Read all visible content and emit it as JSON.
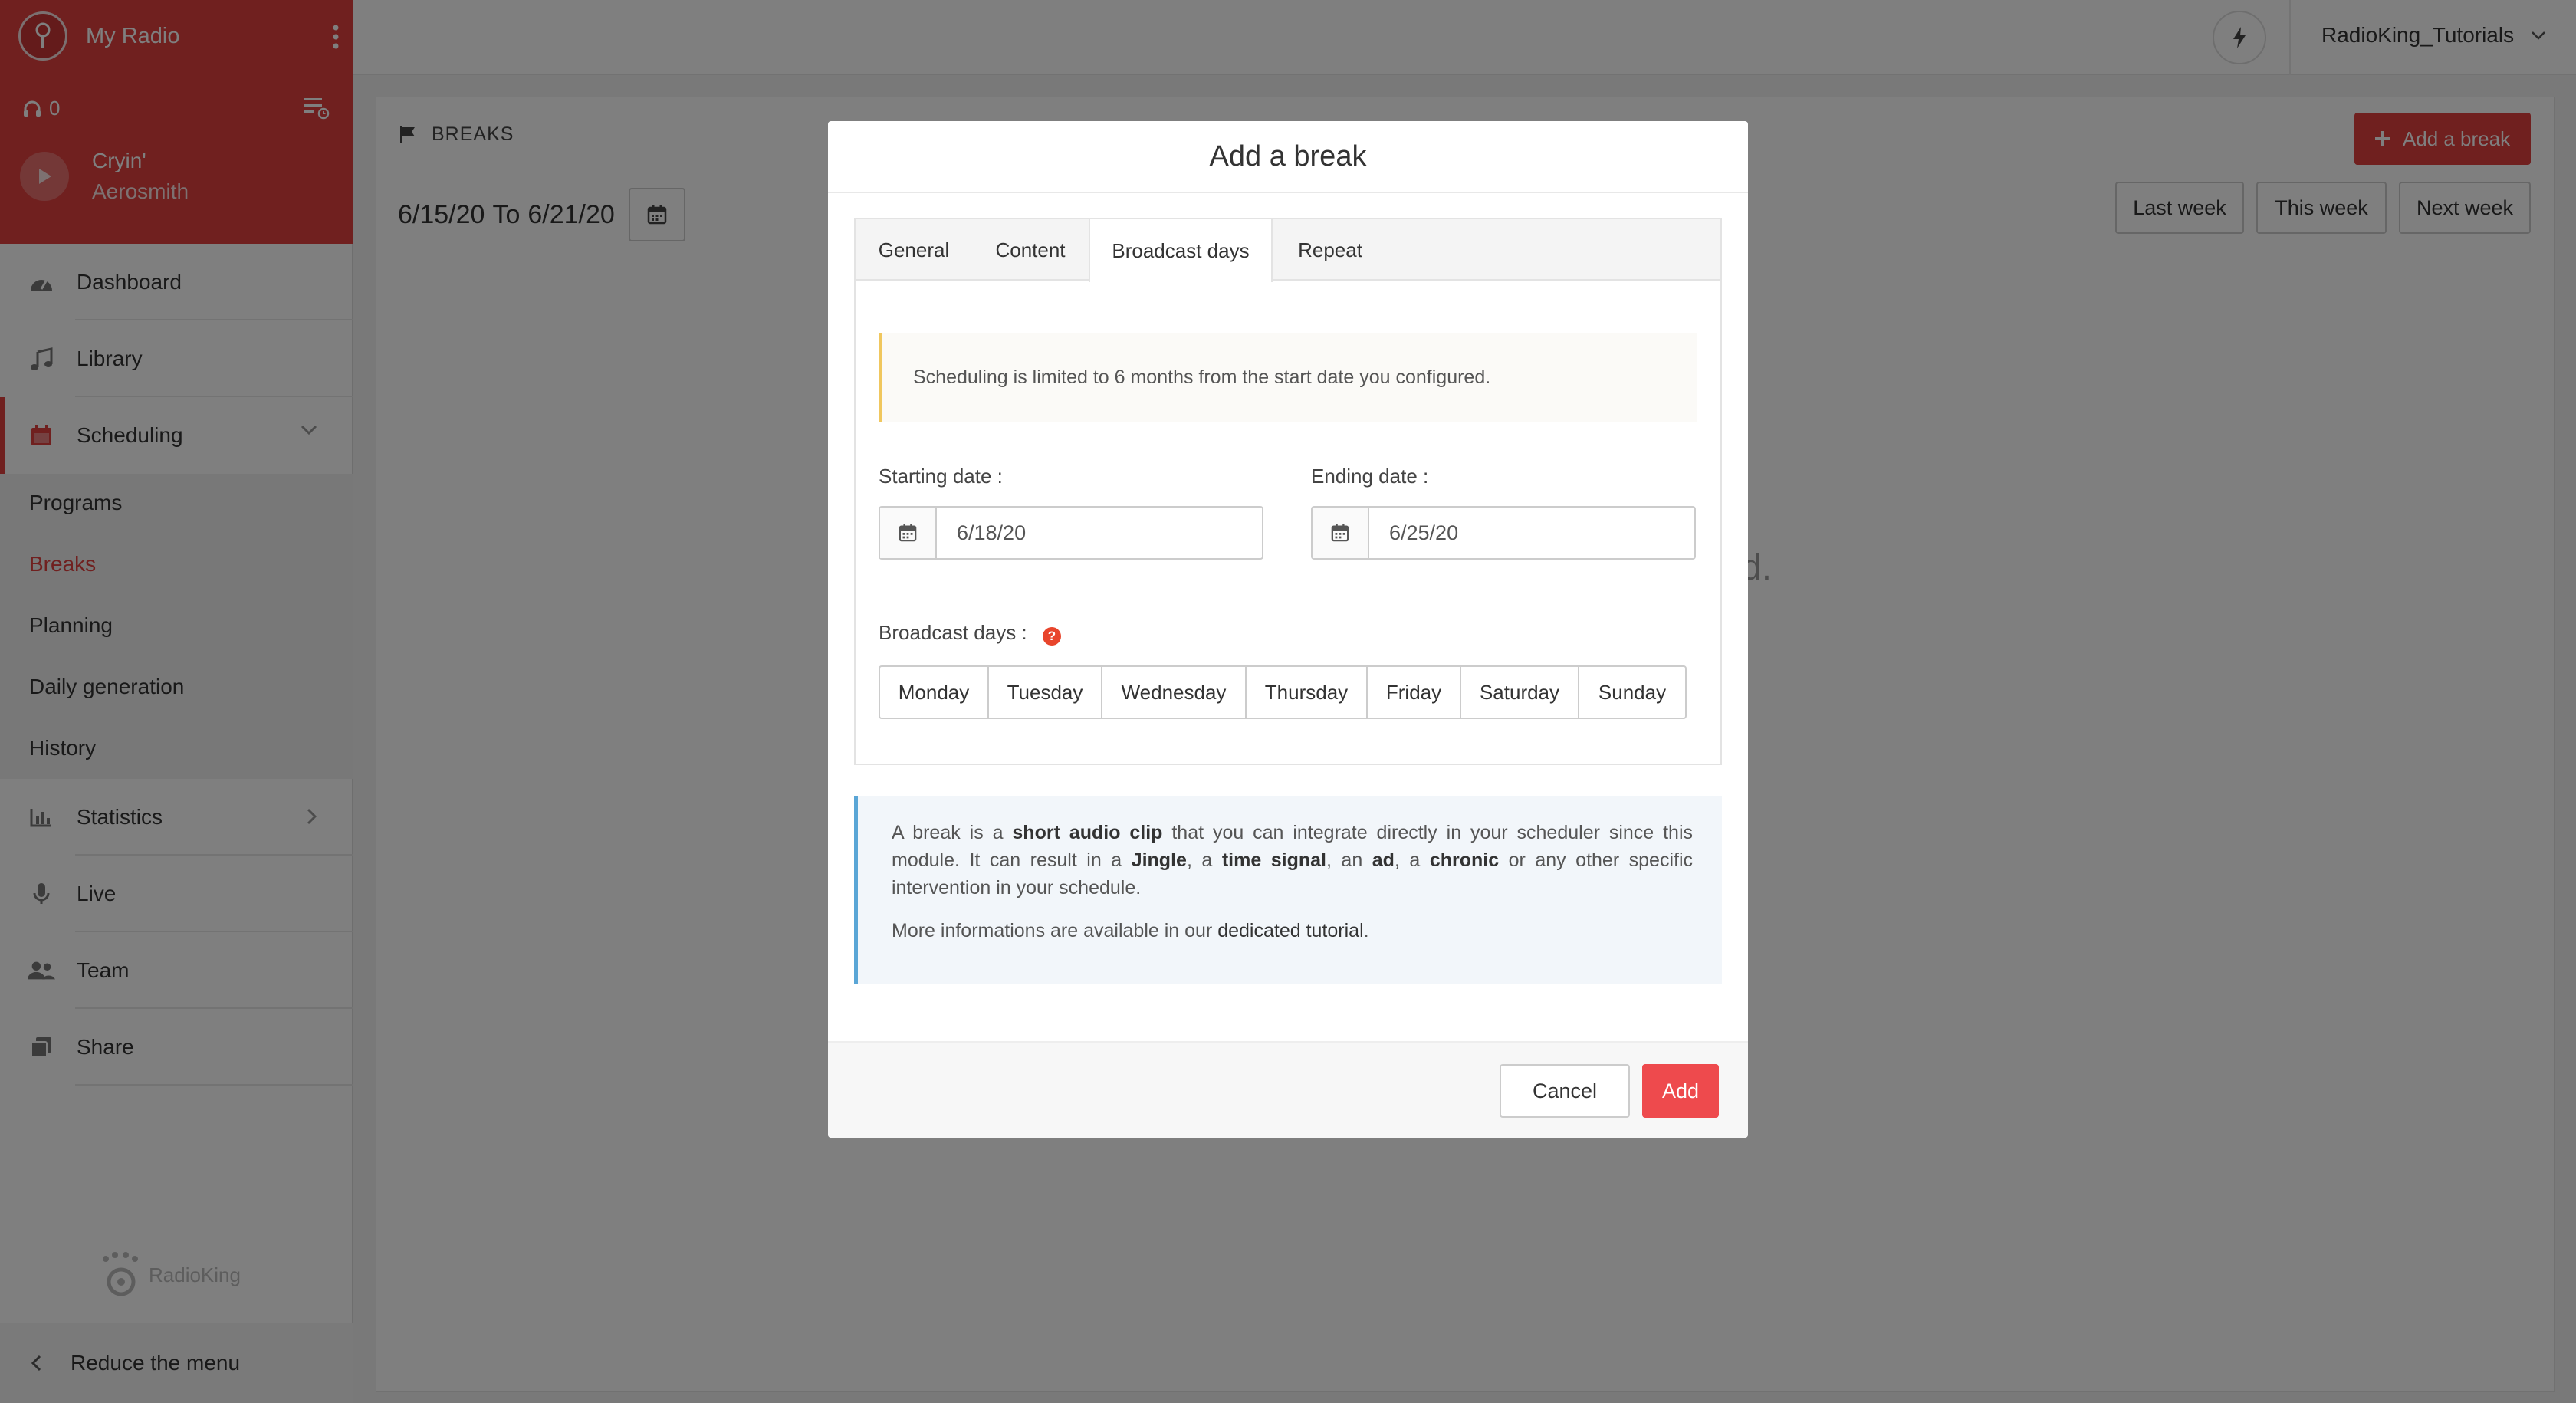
{
  "colors": {
    "accent": "#e0403f",
    "warning": "#f0c75e",
    "info": "#5aa6d6",
    "help": "#e8452c"
  },
  "sidebar": {
    "radio_name": "My Radio",
    "listeners": "0",
    "track": {
      "title": "Cryin'",
      "artist": "Aerosmith"
    },
    "items": [
      {
        "label": "Dashboard",
        "icon": "gauge-icon"
      },
      {
        "label": "Library",
        "icon": "music-note-icon"
      },
      {
        "label": "Scheduling",
        "icon": "calendar-icon",
        "active": true
      },
      {
        "label": "Statistics",
        "icon": "bar-chart-icon"
      },
      {
        "label": "Live",
        "icon": "microphone-icon"
      },
      {
        "label": "Team",
        "icon": "users-icon"
      },
      {
        "label": "Share",
        "icon": "share-icon"
      }
    ],
    "sub_items": [
      {
        "label": "Programs"
      },
      {
        "label": "Breaks",
        "active": true
      },
      {
        "label": "Planning"
      },
      {
        "label": "Daily generation"
      },
      {
        "label": "History"
      }
    ],
    "brand": "RadioKing",
    "reduce_label": "Reduce the menu"
  },
  "topbar": {
    "username": "RadioKing_Tutorials"
  },
  "main": {
    "section_title": "BREAKS",
    "date_from": "6/15/20",
    "date_to_word": "To",
    "date_to": "6/21/20",
    "add_break_label": "Add a break",
    "week_buttons": [
      "Last week",
      "This week",
      "Next week"
    ],
    "empty_hint_tail": "d."
  },
  "modal": {
    "title": "Add a break",
    "tabs": [
      "General",
      "Content",
      "Broadcast days",
      "Repeat"
    ],
    "active_tab": "Broadcast days",
    "warning": "Scheduling is limited to 6 months from the start date you configured.",
    "starting_label": "Starting date :",
    "starting_value": "6/18/20",
    "ending_label": "Ending date :",
    "ending_value": "6/25/20",
    "days_label": "Broadcast days :",
    "days": [
      "Monday",
      "Tuesday",
      "Wednesday",
      "Thursday",
      "Friday",
      "Saturday",
      "Sunday"
    ],
    "info": {
      "p1_a": "A break is a ",
      "p1_b": "short audio clip",
      "p1_c": " that you can integrate directly in your scheduler since this module. It can result in a ",
      "p1_d": "Jingle",
      "p1_e": ", a ",
      "p1_f": "time signal",
      "p1_g": ", an ",
      "p1_h": "ad",
      "p1_i": ", a ",
      "p1_j": "chronic",
      "p1_k": " or any other specific intervention in your schedule.",
      "p2_a": "More informations are available in our ",
      "p2_b": "dedicated tutorial",
      "p2_c": "."
    },
    "cancel_label": "Cancel",
    "add_label": "Add"
  }
}
